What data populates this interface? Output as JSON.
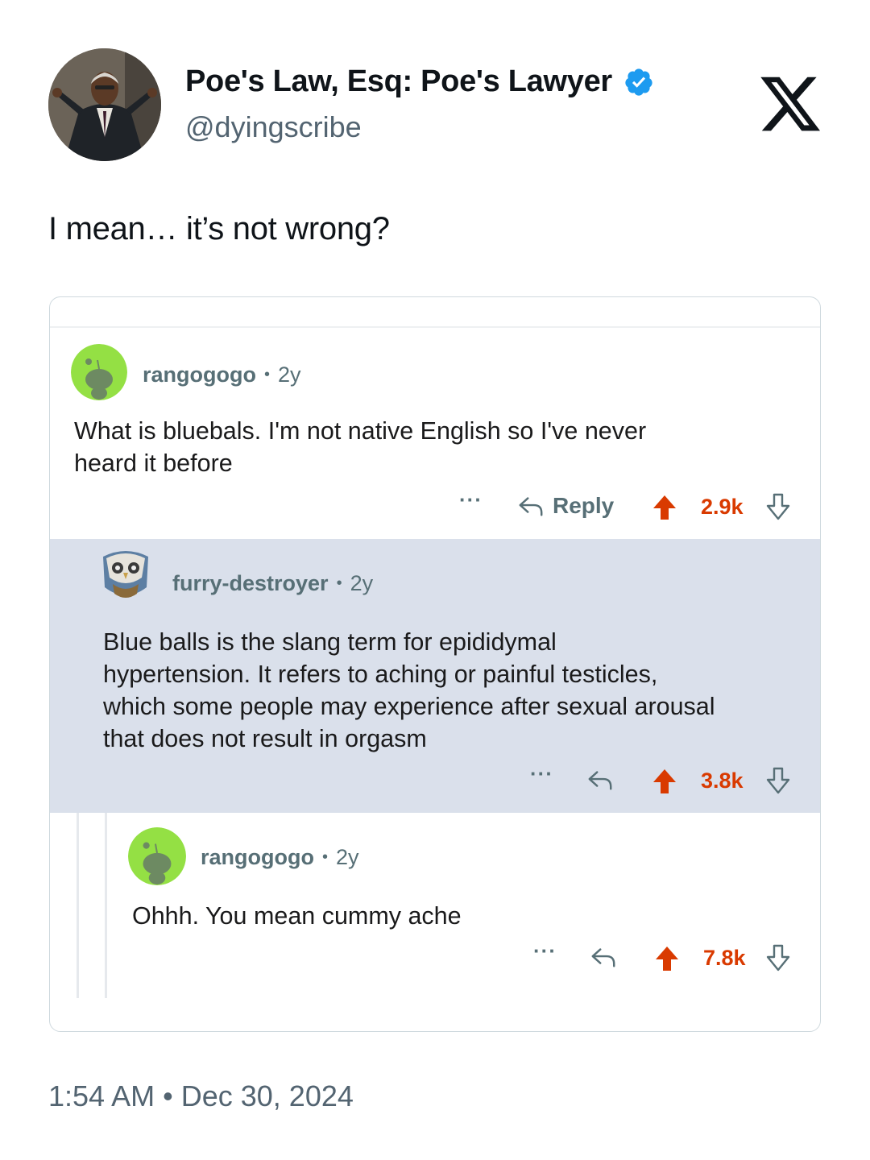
{
  "tweet": {
    "display_name": "Poe's Law, Esq: Poe's Lawyer",
    "handle": "@dyingscribe",
    "text": "I mean… it’s not wrong?",
    "time": "1:54 AM",
    "separator": "•",
    "date": "Dec 30, 2024"
  },
  "embedded_thread": {
    "comments": [
      {
        "user": "rangogogo",
        "age": "2y",
        "text_lines": [
          "What is bluebals. I'm not native English so I've never",
          "heard it before"
        ],
        "reply_label": "Reply",
        "score": "2.9k",
        "more": "···"
      },
      {
        "user": "furry-destroyer",
        "age": "2y",
        "text_lines": [
          "Blue balls is the slang term for epididymal",
          "hypertension. It refers to aching or painful testicles,",
          "which some people may experience after sexual arousal",
          "that does not result in orgasm"
        ],
        "score": "3.8k",
        "more": "···"
      },
      {
        "user": "rangogogo",
        "age": "2y",
        "text_lines": [
          "Ohhh. You mean cummy ache"
        ],
        "score": "7.8k",
        "more": "···"
      }
    ]
  },
  "colors": {
    "verified": "#1d9bf0",
    "upvote": "#d93a00",
    "highlight_bg": "#dae0eb",
    "muted": "#536471"
  },
  "icons": [
    "verified-badge-icon",
    "x-logo-icon",
    "reply-arrow-icon",
    "upvote-arrow-icon",
    "downvote-arrow-icon",
    "more-options-icon"
  ]
}
